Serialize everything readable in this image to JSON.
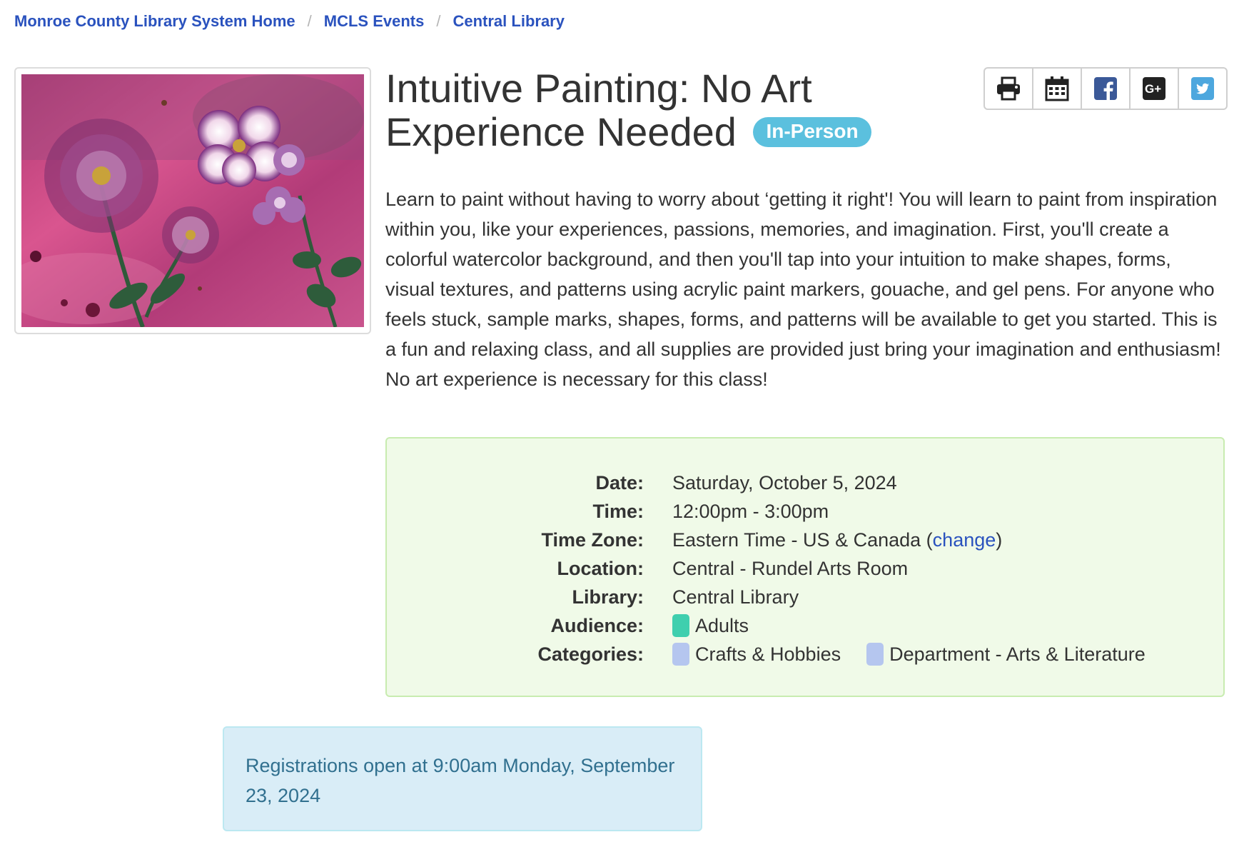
{
  "breadcrumb": {
    "items": [
      "Monroe County Library System Home",
      "MCLS Events",
      "Central Library"
    ],
    "separator": "/"
  },
  "event": {
    "image_alt": "Watercolor painting of purple flowers on a pink background",
    "title": "Intuitive Painting: No Art Experience Needed",
    "badge": "In-Person",
    "description": "Learn to paint without having to worry about ‘getting it right'!  You will learn to paint from inspiration within you, like your experiences, passions, memories, and imagination. First, you'll create a colorful watercolor background, and then you'll tap into your intuition to make shapes, forms, visual textures, and patterns using acrylic paint markers, gouache, and gel pens. For anyone who feels stuck, sample marks, shapes, forms, and patterns will be available to get you started. This is a fun and relaxing class, and all supplies are provided just bring your imagination and enthusiasm! No art experience is necessary for this class!"
  },
  "share": {
    "icons": [
      "print-icon",
      "calendar-icon",
      "facebook-icon",
      "google-plus-icon",
      "twitter-icon"
    ]
  },
  "details": {
    "date_label": "Date:",
    "date": "Saturday, October 5, 2024",
    "time_label": "Time:",
    "time": "12:00pm - 3:00pm",
    "timezone_label": "Time Zone:",
    "timezone": "Eastern Time - US & Canada",
    "timezone_paren_open": "(",
    "timezone_change": "change",
    "timezone_paren_close": ")",
    "location_label": "Location:",
    "location": "Central - Rundel Arts Room",
    "library_label": "Library:",
    "library": "Central Library",
    "audience_label": "Audience:",
    "audience": "Adults",
    "audience_color": "#3fcfae",
    "categories_label": "Categories:",
    "categories": [
      "Crafts & Hobbies",
      "Department - Arts & Literature"
    ],
    "category_color": "#b5c6ef"
  },
  "notice": {
    "text": "Registrations open at 9:00am Monday, September 23, 2024"
  },
  "colors": {
    "link": "#2a52be",
    "badge": "#5bc0de",
    "details_bg": "#f0fae8",
    "notice_bg": "#d9edf7",
    "notice_text": "#31708f"
  }
}
